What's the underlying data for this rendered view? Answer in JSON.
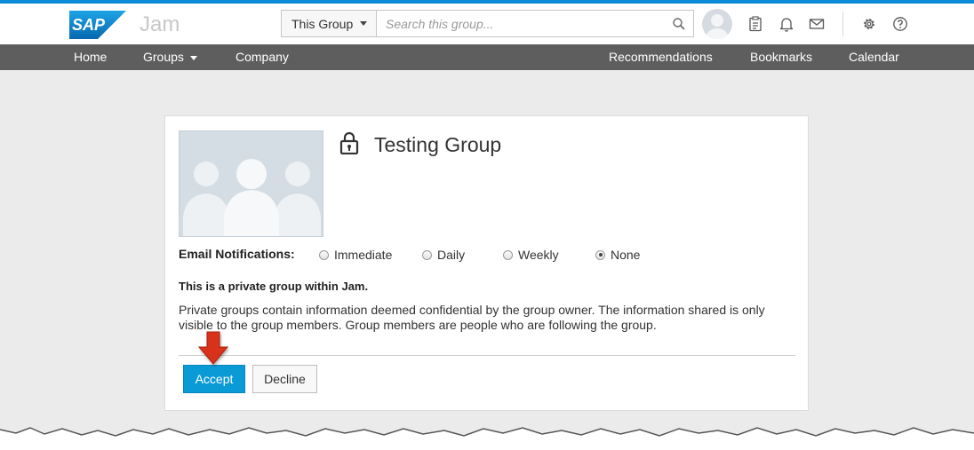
{
  "header": {
    "logo_text": "SAP",
    "app_name": "Jam",
    "scope_selector": "This Group",
    "search_placeholder": "Search this group...",
    "icons": [
      "avatar",
      "tasks-icon",
      "bell-icon",
      "mail-icon",
      "gear-icon",
      "help-icon"
    ]
  },
  "nav": {
    "left": [
      {
        "label": "Home"
      },
      {
        "label": "Groups",
        "has_dropdown": true
      },
      {
        "label": "Company"
      }
    ],
    "right": [
      {
        "label": "Recommendations"
      },
      {
        "label": "Bookmarks"
      },
      {
        "label": "Calendar"
      }
    ]
  },
  "group": {
    "title": "Testing Group",
    "locked": true,
    "email_notifications": {
      "label": "Email Notifications:",
      "options": [
        "Immediate",
        "Daily",
        "Weekly",
        "None"
      ],
      "selected": "None"
    },
    "private_heading": "This is a private group within Jam.",
    "private_description": "Private groups contain information deemed confidential by the group owner. The information shared is only visible to the group members. Group members are people who are following the group.",
    "accept_label": "Accept",
    "decline_label": "Decline"
  },
  "colors": {
    "brand_blue": "#0a8ad6",
    "nav_bg": "#5e5e5e",
    "accept_bg": "#0a9ad5",
    "annotation_arrow": "#d9301f"
  }
}
